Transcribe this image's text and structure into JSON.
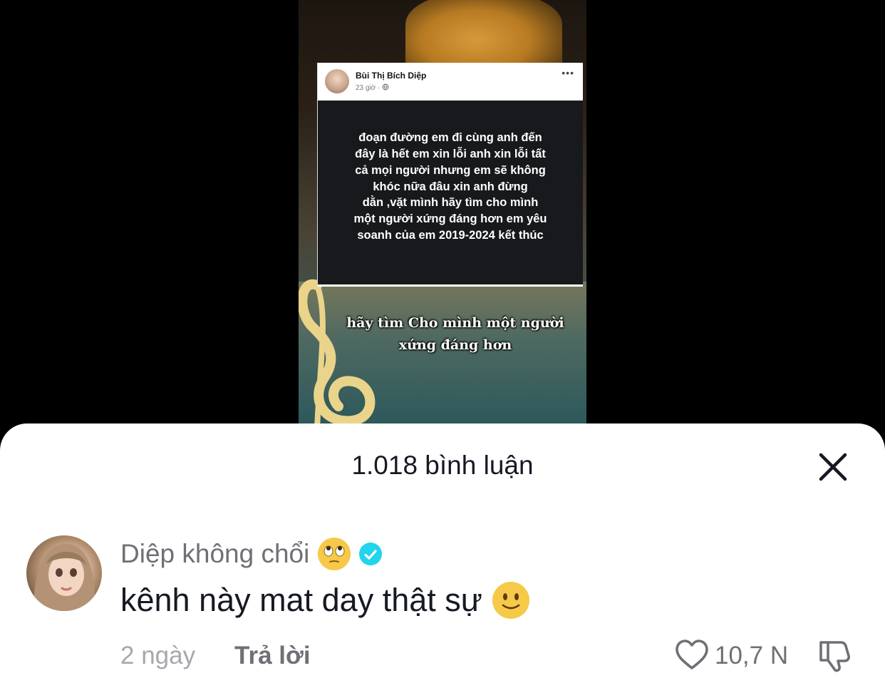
{
  "video": {
    "post": {
      "author": "Bùi Thị Bích Diệp",
      "time": "23 giờ ·",
      "menu": "•••",
      "text": "đoạn đường em đi cùng anh đến\nđây là hết em xin lỗi anh xin lỗi tất\ncả mọi người nhưng em sẽ không\nkhóc nữa đâu xin anh đừng\ndằn ,vặt mình hãy tìm cho mình\nmột người xứng đáng hơn em yêu\nsoanh của em 2019-2024 kết thúc"
    },
    "caption": "hãy tìm Cho mình một người\nxứng đáng hơn"
  },
  "comments_sheet": {
    "title": "1.018 bình luận",
    "close_icon": "close-icon",
    "comment": {
      "author": "Diệp không chổi",
      "author_emoji": "eye-roll-emoji",
      "verified_icon": "verified-badge-icon",
      "text": "kênh này mat day thật sự",
      "text_emoji": "slight-smile-emoji",
      "date": "2 ngày",
      "reply_label": "Trả lời",
      "like_count": "10,7 N",
      "like_icon": "heart-icon",
      "dislike_icon": "thumbs-down-icon"
    }
  },
  "colors": {
    "primary_text": "#161823",
    "secondary_text": "#6f7076",
    "muted_text": "#a7a8ad",
    "verified": "#20d5ec"
  }
}
